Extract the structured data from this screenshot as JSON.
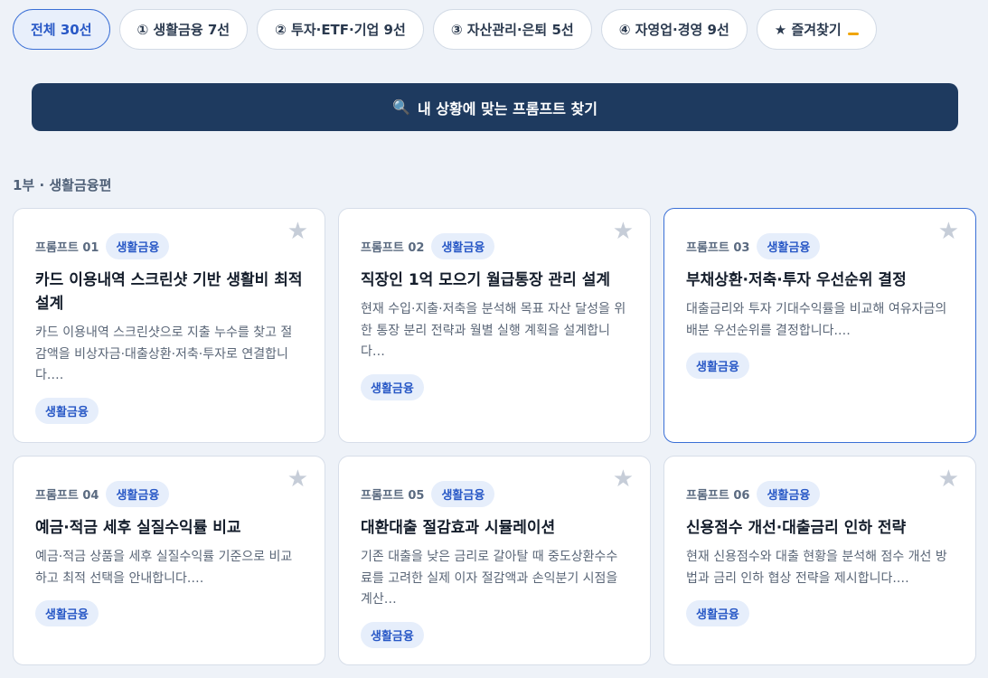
{
  "tabs": [
    {
      "label": "전체 30선",
      "active": true
    },
    {
      "label": "① 생활금융 7선",
      "active": false
    },
    {
      "label": "② 투자·ETF·기업 9선",
      "active": false
    },
    {
      "label": "③ 자산관리·은퇴 5선",
      "active": false
    },
    {
      "label": "④ 자영업·경영 9선",
      "active": false
    },
    {
      "label": "★ 즐겨찾기",
      "active": false
    }
  ],
  "search": {
    "icon": "🔍",
    "label": "내 상황에 맞는 프롬프트 찾기"
  },
  "section": {
    "title": "1부 · 생활금융편"
  },
  "star_icon": "★",
  "cards": [
    {
      "num": "프롬프트 01",
      "category": "생활금융",
      "title": "카드 이용내역 스크린샷 기반 생활비 최적 설계",
      "desc": "카드 이용내역 스크린샷으로 지출 누수를 찾고 절감액을 비상자금·대출상환·저축·투자로 연결합니다.…",
      "tag": "생활금융"
    },
    {
      "num": "프롬프트 02",
      "category": "생활금융",
      "title": "직장인 1억 모으기 월급통장 관리 설계",
      "desc": "현재 수입·지출·저축을 분석해 목표 자산 달성을 위한 통장 분리 전략과 월별 실행 계획을 설계합니다…",
      "tag": "생활금융"
    },
    {
      "num": "프롬프트 03",
      "category": "생활금융",
      "title": "부채상환·저축·투자 우선순위 결정",
      "desc": "대출금리와 투자 기대수익률을 비교해 여유자금의 배분 우선순위를 결정합니다.…",
      "tag": "생활금융"
    },
    {
      "num": "프롬프트 04",
      "category": "생활금융",
      "title": "예금·적금 세후 실질수익률 비교",
      "desc": "예금·적금 상품을 세후 실질수익률 기준으로 비교하고 최적 선택을 안내합니다.…",
      "tag": "생활금융"
    },
    {
      "num": "프롬프트 05",
      "category": "생활금융",
      "title": "대환대출 절감효과 시뮬레이션",
      "desc": "기존 대출을 낮은 금리로 갈아탈 때 중도상환수수료를 고려한 실제 이자 절감액과 손익분기 시점을 계산…",
      "tag": "생활금융"
    },
    {
      "num": "프롬프트 06",
      "category": "생활금융",
      "title": "신용점수 개선·대출금리 인하 전략",
      "desc": "현재 신용점수와 대출 현황을 분석해 점수 개선 방법과 금리 인하 협상 전략을 제시합니다.…",
      "tag": "생활금융"
    }
  ]
}
